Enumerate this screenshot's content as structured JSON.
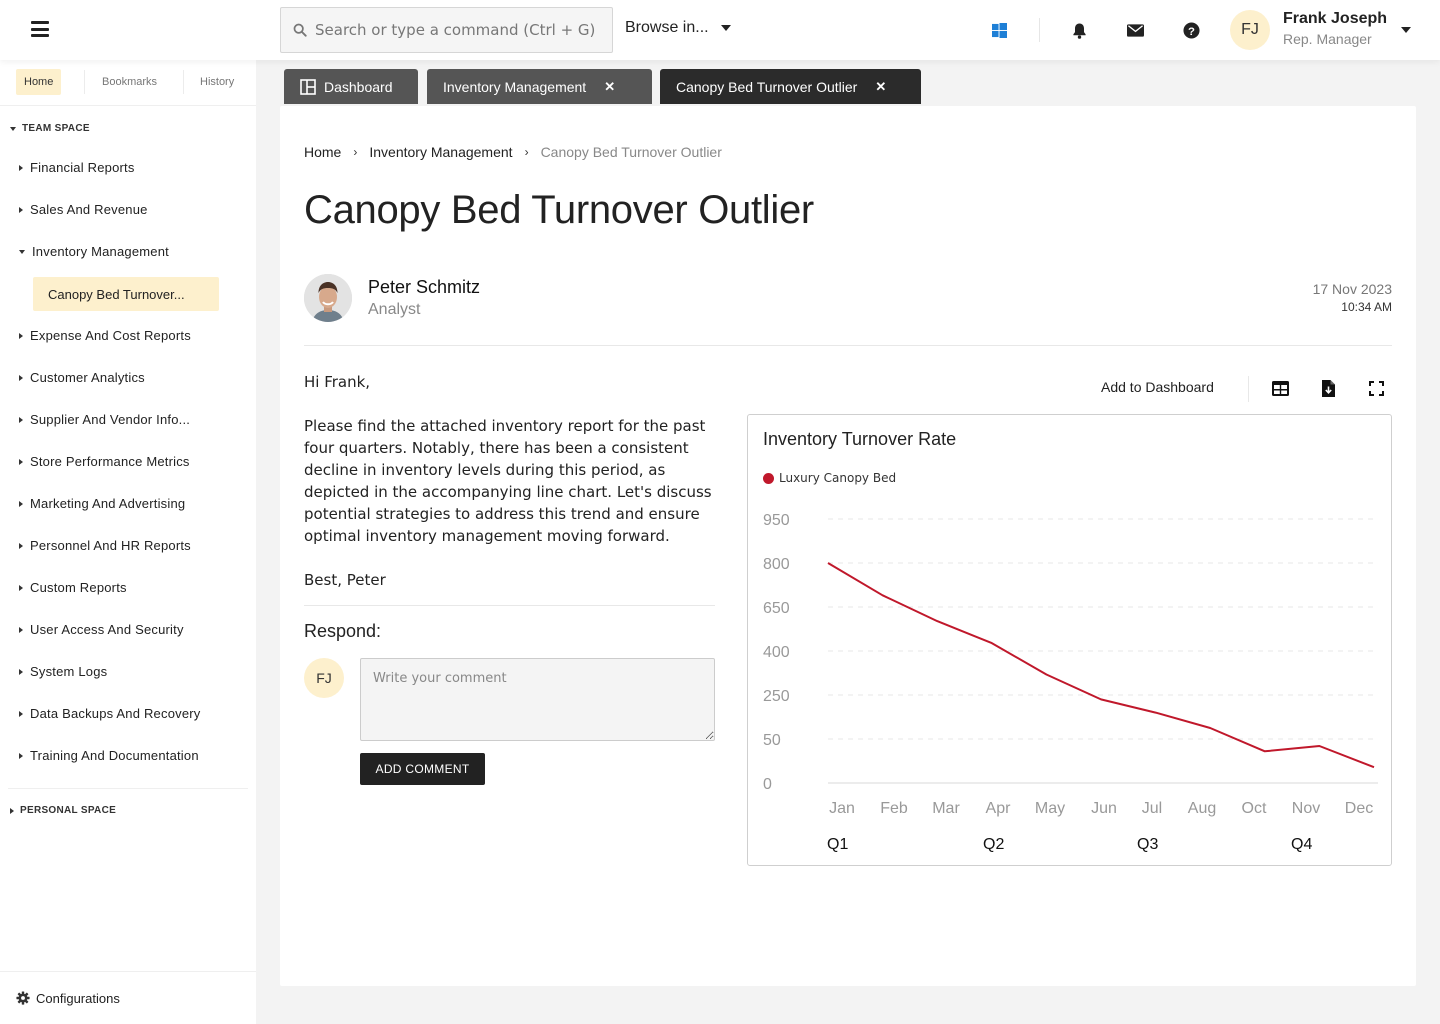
{
  "topbar": {
    "search_placeholder": "Search or type a command (Ctrl + G)",
    "browse_label": "Browse in...",
    "user": {
      "initials": "FJ",
      "name": "Frank Joseph",
      "role": "Rep. Manager"
    },
    "icons": [
      "windows-icon",
      "bell-icon",
      "mail-icon",
      "help-icon"
    ]
  },
  "sidebar": {
    "tabs": [
      "Home",
      "Bookmarks",
      "History"
    ],
    "active_tab": "Home",
    "team_space_label": "TEAM SPACE",
    "items": [
      {
        "label": "Financial Reports",
        "expanded": false
      },
      {
        "label": "Sales And Revenue",
        "expanded": false
      },
      {
        "label": "Inventory Management",
        "expanded": true
      },
      {
        "label": "Expense And Cost Reports",
        "expanded": false
      },
      {
        "label": "Customer Analytics",
        "expanded": false
      },
      {
        "label": "Supplier And Vendor Info...",
        "expanded": false
      },
      {
        "label": "Store Performance Metrics",
        "expanded": false
      },
      {
        "label": "Marketing And Advertising",
        "expanded": false
      },
      {
        "label": "Personnel And HR Reports",
        "expanded": false
      },
      {
        "label": "Custom Reports",
        "expanded": false
      },
      {
        "label": "User Access And Security",
        "expanded": false
      },
      {
        "label": "System Logs",
        "expanded": false
      },
      {
        "label": "Data Backups And Recovery",
        "expanded": false
      },
      {
        "label": "Training And Documentation",
        "expanded": false
      }
    ],
    "sub_item": "Canopy Bed Turnover...",
    "personal_space_label": "PERSONAL SPACE",
    "config_label": "Configurations"
  },
  "tabs": [
    {
      "label": "Dashboard",
      "closable": false,
      "active": false
    },
    {
      "label": "Inventory Management",
      "closable": true,
      "active": false
    },
    {
      "label": "Canopy Bed Turnover Outlier",
      "closable": true,
      "active": true
    }
  ],
  "breadcrumb": [
    "Home",
    "Inventory Management",
    "Canopy Bed Turnover Outlier"
  ],
  "page_title": "Canopy Bed Turnover Outlier",
  "author": {
    "name": "Peter Schmitz",
    "role": "Analyst"
  },
  "posted": {
    "date": "17 Nov 2023",
    "time": "10:34 AM"
  },
  "message": {
    "greeting": "Hi Frank,",
    "body": "Please find the attached inventory report for the past four quarters. Notably, there has been a consistent decline in inventory levels during this period, as depicted in the accompanying line chart. Let's discuss potential strategies to address this trend and ensure optimal inventory management moving forward.",
    "signoff": "Best, Peter"
  },
  "respond": {
    "label": "Respond:",
    "avatar_initials": "FJ",
    "placeholder": "Write your comment",
    "value": "",
    "button": "ADD COMMENT"
  },
  "chart_actions": {
    "add_label": "Add to Dashboard",
    "icons": [
      "table-icon",
      "download-file-icon",
      "fullscreen-icon"
    ]
  },
  "chart_data": {
    "type": "line",
    "title": "Inventory Turnover Rate",
    "xlabel": "",
    "ylabel": "",
    "categories": [
      "Jan",
      "Feb",
      "Mar",
      "Apr",
      "May",
      "Jun",
      "Jul",
      "Aug",
      "Oct",
      "Nov",
      "Dec"
    ],
    "quarter_labels": [
      {
        "label": "Q1",
        "at": "Jan"
      },
      {
        "label": "Q2",
        "at": "Apr"
      },
      {
        "label": "Q3",
        "at": "Jul"
      },
      {
        "label": "Q4",
        "at": "Nov"
      }
    ],
    "y_ticks": [
      0,
      50,
      250,
      400,
      650,
      800,
      950
    ],
    "ylim": [
      0,
      950
    ],
    "grid": true,
    "legend_position": "top-left",
    "series": [
      {
        "name": "Luxury Canopy Bed",
        "color": "#c0182b",
        "values": [
          800,
          690,
          570,
          445,
          320,
          230,
          170,
          100,
          36,
          42,
          18
        ]
      }
    ]
  }
}
